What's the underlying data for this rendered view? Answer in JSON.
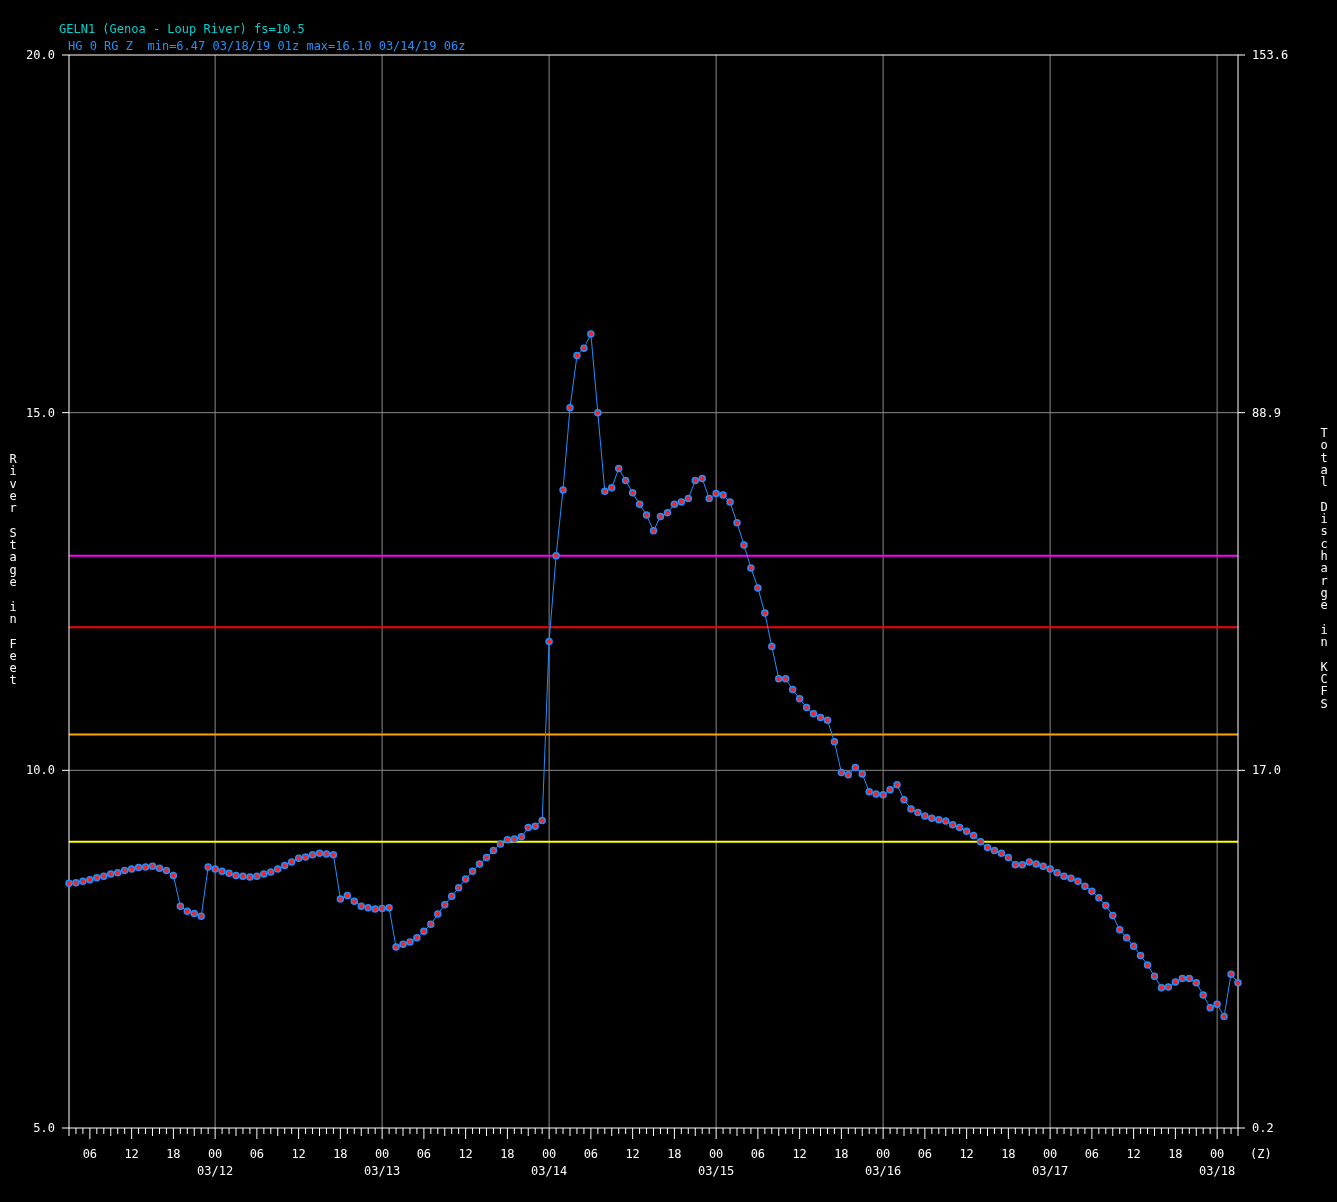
{
  "header": {
    "title": "GELN1 (Genoa - Loup River) fs=10.5",
    "subtitle": "HG 0 RG Z  min=6.47 03/18/19 01z max=16.10 03/14/19 06z"
  },
  "right_axis": {
    "title": "Total Discharge in KCFS",
    "labels": [
      "153.6",
      "88.9",
      "17.0",
      "0.2"
    ]
  },
  "time_axis": {
    "dates": [
      "03/12",
      "03/13",
      "03/14",
      "03/15",
      "03/16",
      "03/17",
      "03/18"
    ],
    "unit": "(Z)"
  },
  "chart": {
    "chart_data": {
      "type": "line",
      "ylabel": "River Stage in Feet",
      "ylim": [
        5,
        20
      ],
      "yticks": [
        {
          "value": 20,
          "label": "20.0"
        },
        {
          "value": 15,
          "label": "15.0"
        },
        {
          "value": 10,
          "label": "10.0"
        },
        {
          "value": 5,
          "label": "5.0"
        }
      ],
      "categories": [
        null,
        null,
        null,
        "06",
        null,
        null,
        null,
        null,
        null,
        "12",
        null,
        null,
        null,
        null,
        null,
        "18",
        null,
        null,
        null,
        null,
        null,
        "00",
        null,
        null,
        null,
        null,
        null,
        "06",
        null,
        null,
        null,
        null,
        null,
        "12",
        null,
        null,
        null,
        null,
        null,
        "18",
        null,
        null,
        null,
        null,
        null,
        "00",
        null,
        null,
        null,
        null,
        null,
        "06",
        null,
        null,
        null,
        null,
        null,
        "12",
        null,
        null,
        null,
        null,
        null,
        "18",
        null,
        null,
        null,
        null,
        null,
        "00",
        null,
        null,
        null,
        null,
        null,
        "06",
        null,
        null,
        null,
        null,
        null,
        "12",
        null,
        null,
        null,
        null,
        null,
        "18",
        null,
        null,
        null,
        null,
        null,
        "00",
        null,
        null,
        null,
        null,
        null,
        "06",
        null,
        null,
        null,
        null,
        null,
        "12",
        null,
        null,
        null,
        null,
        null,
        "18",
        null,
        null,
        null,
        null,
        null,
        "00",
        null,
        null,
        null,
        null,
        null,
        "06",
        null,
        null,
        null,
        null,
        null,
        "12",
        null,
        null,
        null,
        null,
        null,
        "18",
        null,
        null,
        null,
        null,
        null,
        "00",
        null,
        null,
        null,
        null,
        null,
        "06",
        null,
        null,
        null,
        null,
        null,
        "12",
        null,
        null,
        null,
        null,
        null,
        "18",
        null,
        null,
        null,
        null,
        null,
        "00",
        null,
        null,
        null
      ],
      "ref_lines": [
        {
          "axis": "y",
          "value": 13.0,
          "color": "#ff00ff"
        },
        {
          "axis": "y",
          "value": 12.0,
          "color": "#ff0000"
        },
        {
          "axis": "y",
          "value": 10.5,
          "color": "#ffa500"
        },
        {
          "axis": "y",
          "value": 9.0,
          "color": "#ffff00"
        }
      ],
      "series": [
        {
          "color": "#1e90ff",
          "marker": "circle",
          "values": [
            8.42,
            8.43,
            8.45,
            8.47,
            8.5,
            8.52,
            8.55,
            8.57,
            8.6,
            8.62,
            8.64,
            8.65,
            8.66,
            8.63,
            8.6,
            8.53,
            8.1,
            8.03,
            8.0,
            7.96,
            8.65,
            8.62,
            8.59,
            8.56,
            8.53,
            8.52,
            8.51,
            8.52,
            8.55,
            8.58,
            8.62,
            8.67,
            8.72,
            8.77,
            8.79,
            8.82,
            8.84,
            8.83,
            8.82,
            8.2,
            8.25,
            8.17,
            8.1,
            8.08,
            8.06,
            8.07,
            8.08,
            7.53,
            7.57,
            7.6,
            7.66,
            7.75,
            7.85,
            7.99,
            8.12,
            8.24,
            8.36,
            8.48,
            8.59,
            8.69,
            8.78,
            8.88,
            8.97,
            9.03,
            9.04,
            9.07,
            9.2,
            9.22,
            9.3,
            11.8,
            13.0,
            13.92,
            15.07,
            15.8,
            15.9,
            16.1,
            15.0,
            13.9,
            13.95,
            14.22,
            14.05,
            13.88,
            13.72,
            13.57,
            13.35,
            13.55,
            13.6,
            13.72,
            13.75,
            13.8,
            14.05,
            14.08,
            13.8,
            13.87,
            13.85,
            13.75,
            13.46,
            13.15,
            12.83,
            12.55,
            12.2,
            11.73,
            11.28,
            11.28,
            11.13,
            11.0,
            10.88,
            10.79,
            10.74,
            10.7,
            10.4,
            9.97,
            9.94,
            10.04,
            9.95,
            9.7,
            9.67,
            9.66,
            9.73,
            9.8,
            9.59,
            9.46,
            9.41,
            9.36,
            9.33,
            9.31,
            9.29,
            9.24,
            9.2,
            9.15,
            9.09,
            9.0,
            8.92,
            8.88,
            8.84,
            8.78,
            8.68,
            8.68,
            8.72,
            8.69,
            8.66,
            8.62,
            8.57,
            8.52,
            8.49,
            8.45,
            8.38,
            8.31,
            8.22,
            8.11,
            7.97,
            7.77,
            7.66,
            7.54,
            7.41,
            7.28,
            7.12,
            6.96,
            6.97,
            7.04,
            7.09,
            7.09,
            7.03,
            6.86,
            6.68,
            6.73,
            6.56,
            7.15,
            7.03
          ]
        }
      ]
    }
  }
}
